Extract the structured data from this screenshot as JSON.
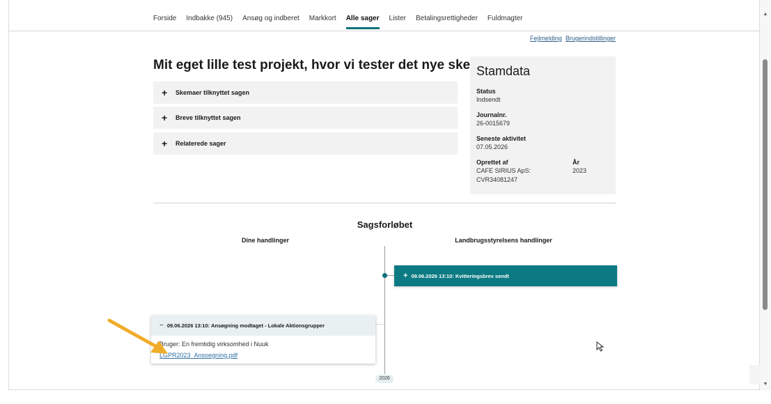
{
  "nav": {
    "items": [
      "Forside",
      "Indbakke (945)",
      "Ansøg og indberet",
      "Markkort",
      "Alle sager",
      "Lister",
      "Betalingsrettigheder",
      "Fuldmagter"
    ],
    "active": "Alle sager"
  },
  "util_links": {
    "fejlmelding": "Fejlmelding",
    "brugerindstillinger": "Brugerindstillinger"
  },
  "page_title": "Mit eget lille test projekt, hvor vi tester det nye skema.",
  "accordions": [
    {
      "label": "Skemaer tilknyttet sagen"
    },
    {
      "label": "Breve tilknyttet sagen"
    },
    {
      "label": "Relaterede sager"
    }
  ],
  "accordion_symbol": "+",
  "stamdata": {
    "title": "Stamdata",
    "status_label": "Status",
    "status_value": "Indsendt",
    "journal_label": "Journalnr.",
    "journal_value": "26-0015679",
    "activity_label": "Seneste aktivitet",
    "activity_value": "07.05.2026",
    "created_label": "Oprettet af",
    "created_value_line1": "CAFE SIRIUS ApS:",
    "created_value_line2": "CVR34081247",
    "year_label": "År",
    "year_value": "2023"
  },
  "timeline": {
    "title": "Sagsforløbet",
    "left_header": "Dine handlinger",
    "right_header": "Landbrugsstyrelsens handlinger",
    "right_event": {
      "sign": "+",
      "text": "09.06.2026 13:10: Kvitteringsbrev sendt"
    },
    "left_event": {
      "sign": "−",
      "text": "09.06.2026 13:10: Ansøgning modtaget - Lokale Aktionsgrupper",
      "user": "Bruger: En fremtidig virksomhed i Nuuk",
      "file": "LGPR2023_Ansoegning.pdf"
    },
    "year_badge": "2026"
  },
  "colors": {
    "accent": "#0b7a82",
    "panel": "#f2f2f2",
    "link": "#2e6fa3",
    "arrow": "#f0ac28"
  },
  "scrollbar": {
    "up": "▲",
    "down": "▼"
  }
}
